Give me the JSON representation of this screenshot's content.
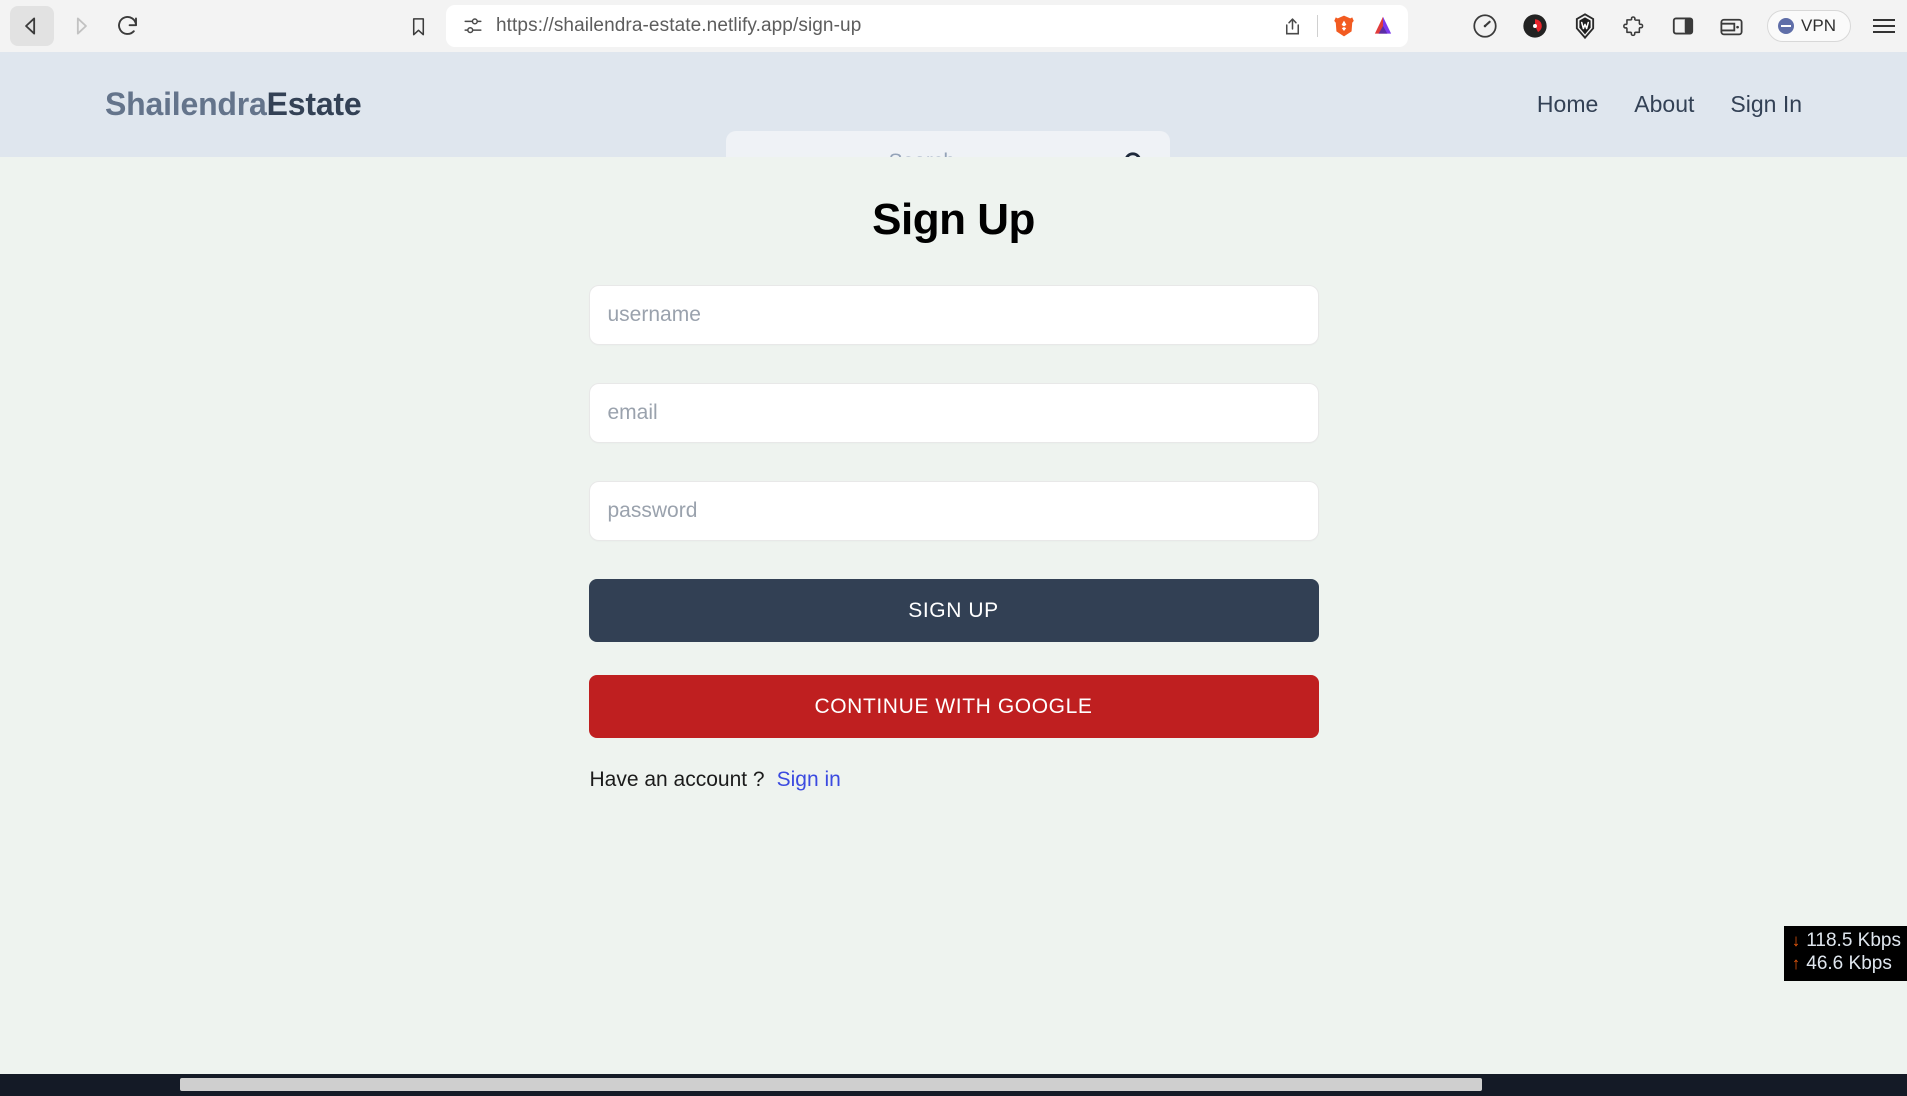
{
  "browser": {
    "back_label": "back-navigation",
    "forward_label": "forward-navigation",
    "reload_label": "reload-page",
    "bookmark_label": "bookmark",
    "url": "https://shailendra-estate.netlify.app/sign-up",
    "url_scheme": "https://",
    "url_host": "shailendra-estate.netlify.app",
    "url_path": "/sign-up",
    "share_label": "share-page",
    "brave_shields_label": "brave-shields",
    "bat_label": "brave-rewards",
    "toolbar_icons": [
      {
        "name": "speedometer-icon",
        "label": "performance"
      },
      {
        "name": "media-record-icon",
        "label": "media"
      },
      {
        "name": "wallet-badge-icon",
        "label": "crypto-wallet"
      },
      {
        "name": "puzzle-icon",
        "label": "extensions"
      },
      {
        "name": "sidebar-panel-icon",
        "label": "sidebar"
      },
      {
        "name": "wallet-icon",
        "label": "wallet"
      }
    ],
    "vpn_label": "VPN",
    "menu_label": "browser-menu"
  },
  "site": {
    "brand_part1": "Shailendra",
    "brand_part2": "Estate",
    "search": {
      "placeholder": "Search...",
      "value": "",
      "icon": "search-icon"
    },
    "nav": [
      {
        "label": "Home"
      },
      {
        "label": "About"
      },
      {
        "label": "Sign In"
      }
    ]
  },
  "main": {
    "title": "Sign Up",
    "fields": [
      {
        "name": "username",
        "placeholder": "username",
        "value": "",
        "type": "text"
      },
      {
        "name": "email",
        "placeholder": "email",
        "value": "",
        "type": "text"
      },
      {
        "name": "password",
        "placeholder": "password",
        "value": "",
        "type": "password"
      }
    ],
    "submit_label": "SIGN UP",
    "google_label": "CONTINUE WITH GOOGLE",
    "footer_text": "Have an account ?",
    "footer_link": "Sign in"
  },
  "network_monitor": {
    "download": "118.5 Kbps",
    "upload": "46.6 Kbps",
    "down_arrow": "↓",
    "up_arrow": "↑"
  },
  "colors": {
    "header_bg": "#dfe6ee",
    "page_bg": "#eef3ef",
    "brand_light": "#64748b",
    "brand_dark": "#334155",
    "signup_button": "#324054",
    "google_button": "#bf1f20",
    "link_blue": "#3b4ae0"
  }
}
